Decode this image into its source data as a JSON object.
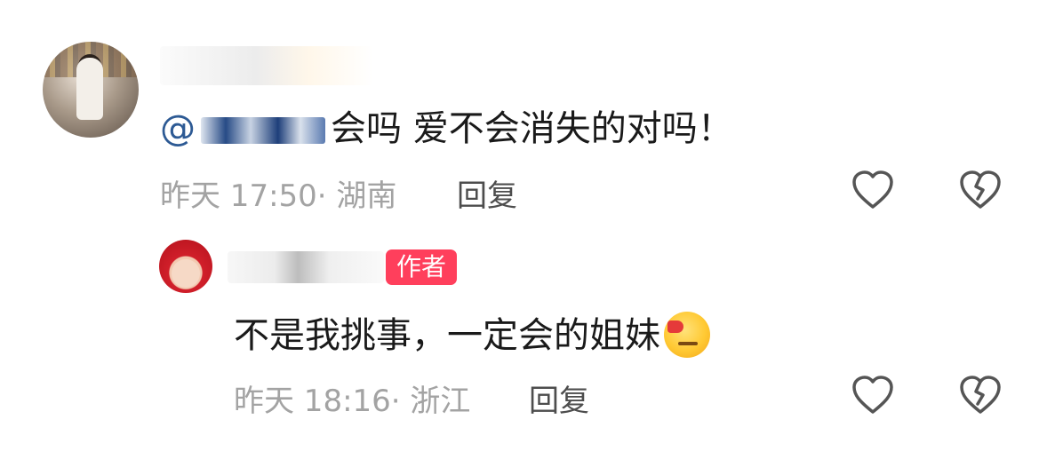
{
  "comment": {
    "mention_at": "@",
    "text": "会吗 爱不会消失的对吗！",
    "time_location": "昨天 17:50· 湖南",
    "reply_label": "回复",
    "like_icon": "heart-outline-icon",
    "dislike_icon": "broken-heart-icon"
  },
  "reply": {
    "author_badge": "作者",
    "text": "不是我挑事，一定会的姐妹",
    "emoji": "smirk-emoji",
    "time_location": "昨天 18:16· 浙江",
    "reply_label": "回复",
    "like_icon": "heart-outline-icon",
    "dislike_icon": "broken-heart-icon"
  },
  "colors": {
    "text": "#1a1a1a",
    "meta": "#a3a3a3",
    "mention": "#2d5a94",
    "badge": "#ff3f5c",
    "icon": "#555555"
  }
}
